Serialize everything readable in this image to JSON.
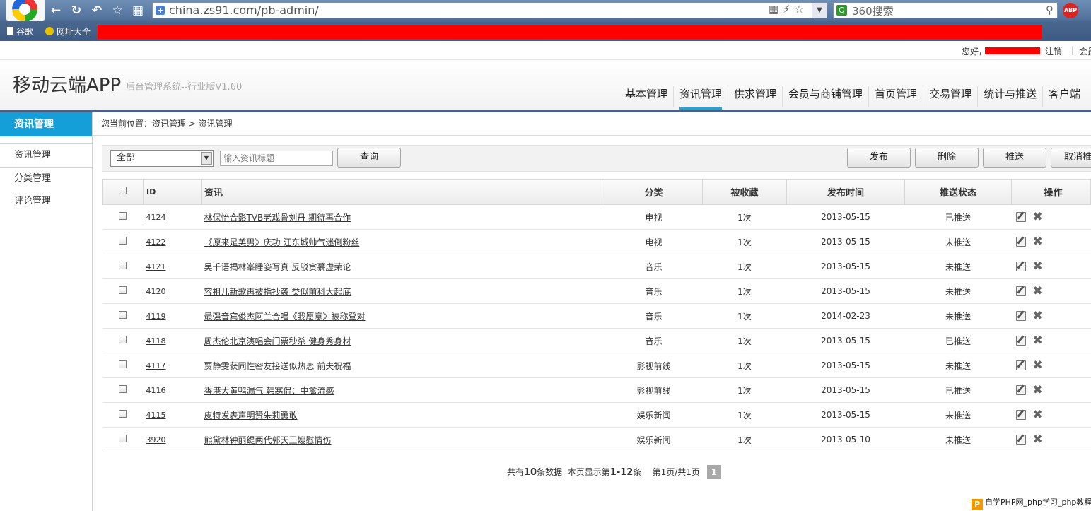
{
  "browser": {
    "url": "china.zs91.com/pb-admin/",
    "search_placeholder": "360搜索",
    "abp": "ABP",
    "bookmarks": [
      "谷歌",
      "网址大全"
    ]
  },
  "toplinks": {
    "greeting": "您好，",
    "logout": "注销",
    "separator": "|",
    "member": "会员"
  },
  "header": {
    "app_name": "移动云端APP",
    "subtitle": "后台管理系统--行业版V1.60",
    "nav": [
      "基本管理",
      "资讯管理",
      "供求管理",
      "会员与商铺管理",
      "首页管理",
      "交易管理",
      "统计与推送",
      "客户端"
    ],
    "active_nav": 1
  },
  "sidebar": {
    "title": "资讯管理",
    "items": [
      "资讯管理",
      "分类管理",
      "评论管理"
    ]
  },
  "breadcrumb": "您当前位置：资讯管理 > 资讯管理",
  "toolbar": {
    "select_value": "全部",
    "input_placeholder": "输入资讯标题",
    "query": "查询",
    "publish": "发布",
    "delete": "删除",
    "push": "推送",
    "cancel_push": "取消推送"
  },
  "table": {
    "headers": [
      "ID",
      "资讯",
      "分类",
      "被收藏",
      "发布时间",
      "推送状态",
      "操作"
    ],
    "rows": [
      {
        "id": "4124",
        "title": "林保怡合影TVB老戏骨刘丹 期待再合作",
        "category": "电视",
        "fav": "1次",
        "date": "2013-05-15",
        "status": "已推送"
      },
      {
        "id": "4122",
        "title": "《原来是美男》庆功 汪东城帅气迷倒粉丝",
        "category": "电视",
        "fav": "1次",
        "date": "2013-05-15",
        "status": "未推送"
      },
      {
        "id": "4121",
        "title": "吴千语揭林峯睡姿写真 反驳贪慕虚荣论",
        "category": "音乐",
        "fav": "1次",
        "date": "2013-05-15",
        "status": "未推送"
      },
      {
        "id": "4120",
        "title": "容祖儿新歌再被指抄袭 类似前科大起底",
        "category": "音乐",
        "fav": "1次",
        "date": "2013-05-15",
        "status": "未推送"
      },
      {
        "id": "4119",
        "title": "最强音宾俊杰阿兰合唱《我愿意》被称登对",
        "category": "音乐",
        "fav": "1次",
        "date": "2014-02-23",
        "status": "未推送"
      },
      {
        "id": "4118",
        "title": "周杰伦北京演唱会门票秒杀 健身秀身材",
        "category": "音乐",
        "fav": "1次",
        "date": "2013-05-15",
        "status": "已推送"
      },
      {
        "id": "4117",
        "title": "贾静雯获同性密友接送似热恋 前夫祝福",
        "category": "影视前线",
        "fav": "1次",
        "date": "2013-05-15",
        "status": "未推送"
      },
      {
        "id": "4116",
        "title": "香港大黄鸭漏气 韩寒侃：中禽流感",
        "category": "影视前线",
        "fav": "1次",
        "date": "2013-05-15",
        "status": "已推送"
      },
      {
        "id": "4115",
        "title": "皮特发表声明赞朱莉勇敢",
        "category": "娱乐新闻",
        "fav": "1次",
        "date": "2013-05-15",
        "status": "未推送"
      },
      {
        "id": "3920",
        "title": "熊黛林钟丽缇两代郭天王嫂慰情伤",
        "category": "娱乐新闻",
        "fav": "1次",
        "date": "2013-05-10",
        "status": "未推送"
      }
    ]
  },
  "pager": {
    "total_prefix": "共有",
    "total": "10",
    "total_suffix": "条数据",
    "shown_prefix": "本页显示第",
    "shown": "1-12",
    "shown_suffix": "条",
    "page_info": "第1页/共1页",
    "current": "1"
  },
  "watermark": {
    "logo": "P",
    "text": "自学PHP网_php学习_php教程"
  },
  "colors": {
    "accent": "#159fd9",
    "pushed": "#e00000",
    "redaction": "#ff0000"
  }
}
